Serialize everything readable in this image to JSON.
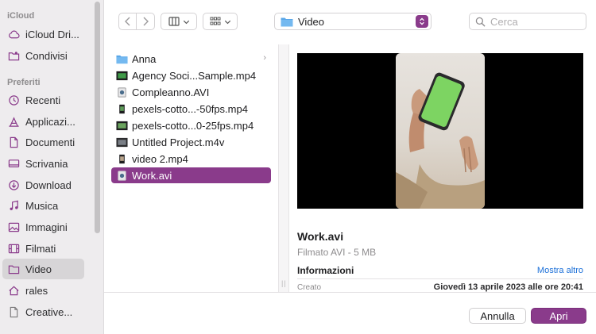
{
  "sidebar": {
    "sections": [
      {
        "title": "iCloud"
      },
      {
        "title": "Preferiti"
      }
    ],
    "icloud_items": [
      {
        "label": "iCloud Dri...",
        "icon": "cloud-icon"
      },
      {
        "label": "Condivisi",
        "icon": "shared-folder-icon"
      }
    ],
    "favorite_items": [
      {
        "label": "Recenti",
        "icon": "clock-icon"
      },
      {
        "label": "Applicazi...",
        "icon": "applications-icon"
      },
      {
        "label": "Documenti",
        "icon": "document-icon"
      },
      {
        "label": "Scrivania",
        "icon": "desktop-icon"
      },
      {
        "label": "Download",
        "icon": "download-icon"
      },
      {
        "label": "Musica",
        "icon": "music-icon"
      },
      {
        "label": "Immagini",
        "icon": "photo-icon"
      },
      {
        "label": "Filmati",
        "icon": "film-icon"
      },
      {
        "label": "Video",
        "icon": "folder-icon",
        "selected": true
      },
      {
        "label": "rales",
        "icon": "home-icon"
      },
      {
        "label": "Creative...",
        "icon": "document-icon"
      }
    ]
  },
  "toolbar": {
    "location": "Video",
    "search_placeholder": "Cerca"
  },
  "files": [
    {
      "label": "Anna",
      "type": "folder"
    },
    {
      "label": "Agency Soci...Sample.mp4",
      "type": "video"
    },
    {
      "label": "Compleanno.AVI",
      "type": "avi"
    },
    {
      "label": "pexels-cotto...-50fps.mp4",
      "type": "video"
    },
    {
      "label": "pexels-cotto...0-25fps.mp4",
      "type": "video"
    },
    {
      "label": "Untitled Project.m4v",
      "type": "video"
    },
    {
      "label": "video 2.mp4",
      "type": "video"
    },
    {
      "label": "Work.avi",
      "type": "avi",
      "selected": true
    }
  ],
  "preview": {
    "title": "Work.avi",
    "subtitle": "Filmato AVI - 5 MB",
    "info_heading": "Informazioni",
    "more_link": "Mostra altro",
    "created_label": "Creato",
    "created_value": "Giovedì 13 aprile 2023 alle ore 20:41"
  },
  "buttons": {
    "cancel": "Annulla",
    "open": "Apri"
  },
  "colors": {
    "accent": "#8a3b8b",
    "link": "#1a6fd8",
    "folder": "#5aa7e8"
  }
}
